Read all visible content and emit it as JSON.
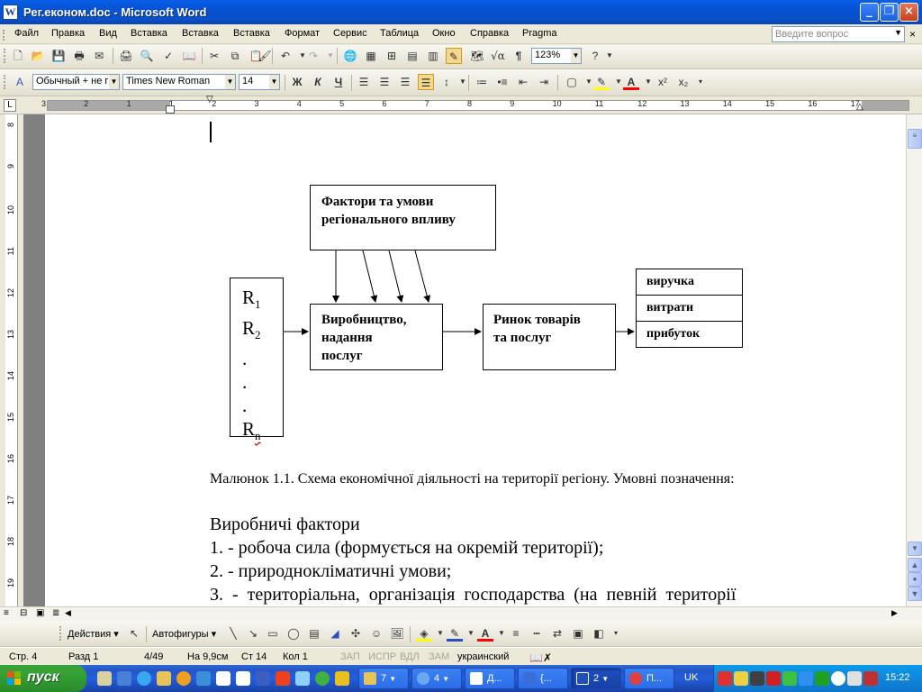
{
  "window": {
    "title": "Рег.економ.doc - Microsoft Word",
    "app_icon": "W"
  },
  "menu": {
    "items": [
      "Файл",
      "Правка",
      "Вид",
      "Вставка",
      "Вставка",
      "Вставка",
      "Формат",
      "Сервис",
      "Таблица",
      "Окно",
      "Справка",
      "Pragma"
    ],
    "help_placeholder": "Введите вопрос"
  },
  "formatting": {
    "style": "Обычный + не г",
    "font": "Times New Roman",
    "size": "14",
    "zoom": "123%",
    "bold": "Ж",
    "italic": "К",
    "underline": "Ч"
  },
  "ruler": {
    "h_numbers": [
      "3",
      "2",
      "1",
      "1",
      "2",
      "3",
      "4",
      "5",
      "6",
      "7",
      "8",
      "9",
      "10",
      "11",
      "12",
      "13",
      "14",
      "15",
      "16",
      "17"
    ],
    "v_numbers": [
      "8",
      "9",
      "10",
      "11",
      "12",
      "13",
      "14",
      "15",
      "16",
      "17",
      "18",
      "19"
    ]
  },
  "diagram": {
    "factors_box": [
      "Фактори та умови",
      "регіонального впливу"
    ],
    "regions": [
      "R",
      "R",
      ".",
      ".",
      ".",
      "R"
    ],
    "region_subs": [
      "1",
      "2",
      "",
      "",
      "",
      "n"
    ],
    "production_box": [
      "Виробництво,",
      "надання",
      "послуг"
    ],
    "market_box": [
      "Ринок товарів",
      "та послуг"
    ],
    "results": [
      "виручка",
      "витрати",
      "прибуток"
    ]
  },
  "document": {
    "caption": "Малюнок 1.1. Схема економічної діяльності на території регіону. Умовні позначення:",
    "heading": "Виробничі фактори",
    "line1": "1. - робоча сила (формується на окремій території);",
    "line2": "2. - природнокліматичні умови;",
    "line3": "3.  -  територіальна,  організація  господарства  (на  певній  території"
  },
  "draw_toolbar": {
    "actions": "Действия",
    "autoshapes": "Автофигуры"
  },
  "status": {
    "page": "Стр.  4",
    "section": "Разд  1",
    "pages": "4/49",
    "at": "На  9,9см",
    "line": "Ст  14",
    "col": "Кол  1",
    "rec": "ЗАП",
    "trk": "ИСПР",
    "ext": "ВДЛ",
    "ovr": "ЗАМ",
    "lang": "украинский"
  },
  "taskbar": {
    "start": "пуск",
    "tasks": [
      {
        "label": "7",
        "icon_color": "#e8c35a"
      },
      {
        "label": "4",
        "icon_color": "#6aa8f0"
      },
      {
        "label": "Д...",
        "icon_color": "#ffffff"
      },
      {
        "label": "{...",
        "icon_color": "#3b6fd8"
      },
      {
        "label": "2",
        "icon_color": "#1f4fb8"
      },
      {
        "label": "П...",
        "icon_color": "#e04040"
      }
    ],
    "lang": "UK",
    "clock": "15:22"
  },
  "colors": {
    "title_blue": "#0553d4",
    "taskbar_blue": "#245edb",
    "start_green": "#35a335",
    "page_bg": "#808080"
  }
}
